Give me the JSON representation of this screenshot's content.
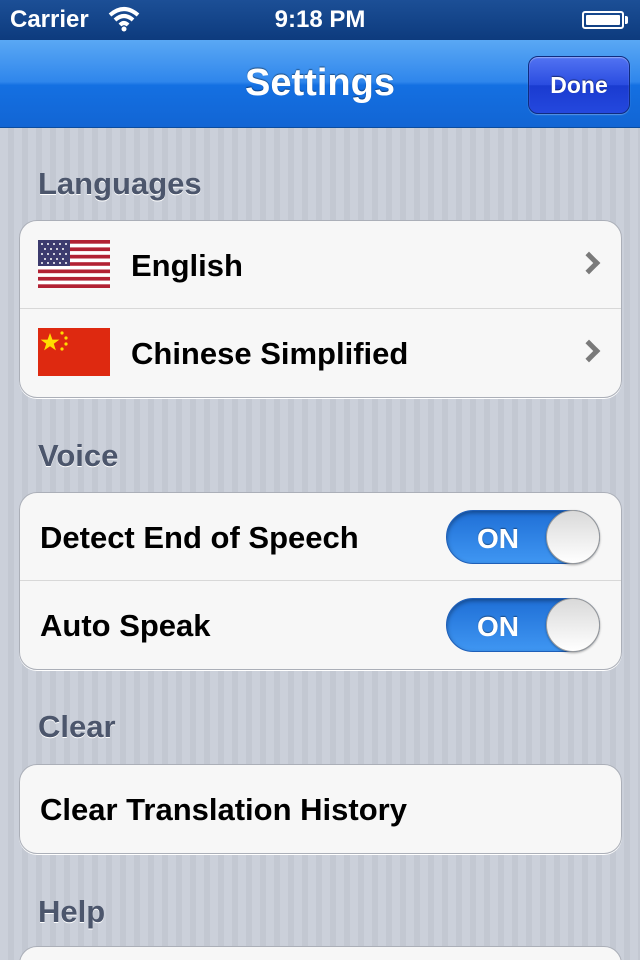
{
  "status_bar": {
    "carrier": "Carrier",
    "time": "9:18 PM"
  },
  "nav": {
    "title": "Settings",
    "done_label": "Done"
  },
  "sections": {
    "languages": {
      "header": "Languages",
      "items": [
        {
          "label": "English",
          "flag": "us-flag-icon"
        },
        {
          "label": "Chinese Simplified",
          "flag": "china-flag-icon"
        }
      ]
    },
    "voice": {
      "header": "Voice",
      "items": [
        {
          "label": "Detect End of Speech",
          "toggle": "ON"
        },
        {
          "label": "Auto Speak",
          "toggle": "ON"
        }
      ]
    },
    "clear": {
      "header": "Clear",
      "items": [
        {
          "label": "Clear Translation History"
        }
      ]
    },
    "help": {
      "header": "Help"
    }
  },
  "colors": {
    "nav_blue": "#2f86ec",
    "done_blue": "#2a4ce0",
    "toggle_blue": "#1f6fd6",
    "section_header": "#4c566c"
  }
}
